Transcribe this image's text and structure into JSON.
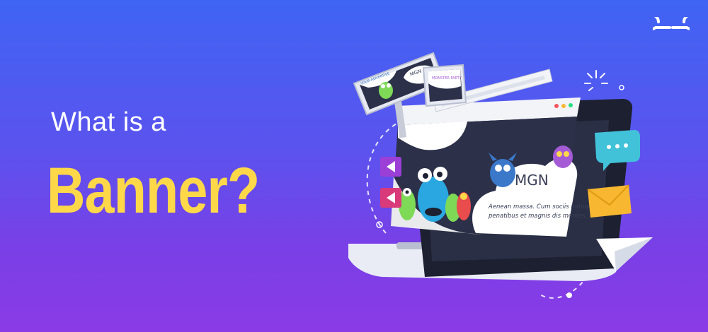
{
  "title": {
    "line1": "What is a",
    "line2": "Banner?"
  },
  "colors": {
    "title_accent": "#ffd84a",
    "bg_top": "#3f64f4",
    "bg_bottom": "#8a3be6"
  },
  "billboard": {
    "small_text": "YOUR ADVERTISE",
    "brand": "MGN",
    "side_text": "MONSTER PARTY"
  },
  "screen": {
    "brand": "MGN",
    "caption_line1": "Aenean massa. Cum sociis natoque",
    "caption_line2": "penatibus et magnis dis montes,"
  },
  "icons": [
    "geeksforgeeks-logo-icon",
    "chat-bubble-icon",
    "envelope-icon",
    "paper-plane-icon",
    "play-left-icon",
    "sparkle-icon"
  ]
}
